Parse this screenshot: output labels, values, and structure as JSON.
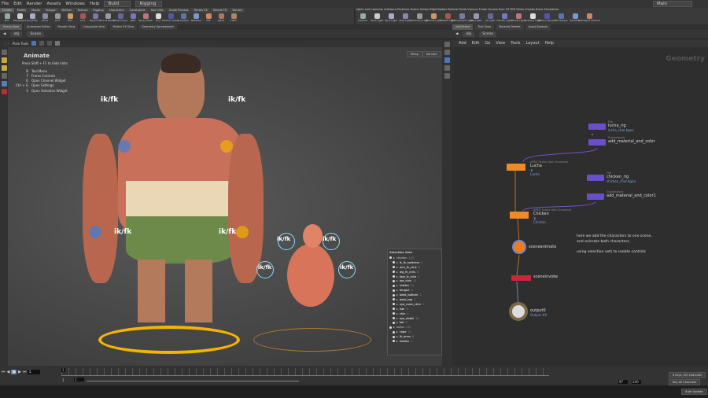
{
  "menubar": {
    "items": [
      "File",
      "Edit",
      "Render",
      "Assets",
      "Windows",
      "Help"
    ],
    "desktop": "Build",
    "context": "Rigging",
    "right_desktop": "Main"
  },
  "shelf_tabs_left": [
    "Create",
    "Modify",
    "Model",
    "Polygon",
    "Deform",
    "Texture",
    "Rigging",
    "Characters",
    "Constraints",
    "Hair Utils",
    "Guide Process",
    "Terrain FX",
    "Simple FX",
    "Volume"
  ],
  "shelf_tabs_right": [
    "Lights and Cameras",
    "Collisions",
    "Particles",
    "Grains",
    "Vellum",
    "Rigid Bodies",
    "Particle Fluids",
    "Viscous Fluids",
    "Oceans",
    "Pyro FX",
    "FEM",
    "Wires",
    "Crowds",
    "Drive Simulation"
  ],
  "shelf_tools_left": [
    "Box",
    "PolySphere",
    "PolyTube",
    "Torus",
    "Grid",
    "Null",
    "Line",
    "PolyCircle",
    "Curve Bezier",
    "Draw Curve",
    "Path",
    "Spray Paint",
    "Font",
    "Platonic Solids",
    "L-System",
    "Metaball",
    "File",
    "Spiral",
    "Helix"
  ],
  "shelf_tools_right": [
    "Camera",
    "Point Light",
    "Spot Light",
    "Area Light",
    "Geometry Light",
    "Volume Light",
    "Distant Light",
    "Environment Light",
    "Sky Light",
    "GI Light",
    "Caustic Light",
    "Portal Light",
    "Ambient Light",
    "Stereo Camera",
    "VR Camera",
    "Switcher",
    "Gamepad Camera"
  ],
  "left_pane_tabs": [
    "Scene View",
    "Animation Editor",
    "Render View",
    "Composite View",
    "Motion FX View",
    "Geometry Spreadsheet"
  ],
  "right_pane_tabs": [
    "/obj/Scene",
    "Tree View",
    "Material Palette",
    "Asset Browser"
  ],
  "path": {
    "obj": "obj",
    "scene": "Scene"
  },
  "viewport": {
    "pose_tools": "Pose Tools",
    "camera": "Persp",
    "lights": "No cam",
    "hud_title": "Animate",
    "hud_hint": "Press Shift + F1 to hide hints",
    "hotkeys": [
      {
        "k": "B",
        "a": "Tool Menu"
      },
      {
        "k": "F",
        "a": "Frame Controls"
      },
      {
        "k": "G",
        "a": "Open Channel Widget"
      },
      {
        "k": "Ctrl + G",
        "a": "Open Settings"
      },
      {
        "k": "V",
        "a": "Open Selection Widget"
      }
    ],
    "ikfk_label": "ik/fk"
  },
  "selection_sets": {
    "title": "Selection Sets",
    "items": [
      {
        "name": "chicken",
        "count": "105",
        "level": 0
      },
      {
        "name": "ik_fk_switches",
        "count": "4",
        "level": 1
      },
      {
        "name": "arm_fk_ctrls",
        "count": "6",
        "level": 1
      },
      {
        "name": "leg_fk_ctrls",
        "count": "6",
        "level": 1
      },
      {
        "name": "foot_ik_ctrls",
        "count": "4",
        "level": 1
      },
      {
        "name": "toe_ctrls",
        "count": "11",
        "level": 1
      },
      {
        "name": "hidden",
        "count": "12",
        "level": 1
      },
      {
        "name": "tongue",
        "count": "4",
        "level": 1
      },
      {
        "name": "beak_bottom",
        "count": "1",
        "level": 1
      },
      {
        "name": "beak_top",
        "count": "1",
        "level": 1
      },
      {
        "name": "eye_main_ctrls",
        "count": "2",
        "level": 1
      },
      {
        "name": "hair",
        "count": "3",
        "level": 1
      },
      {
        "name": "chin",
        "count": "1",
        "level": 1
      },
      {
        "name": "eye_detail",
        "count": "10",
        "level": 1
      },
      {
        "name": "tail",
        "count": "3",
        "level": 1
      },
      {
        "name": "lucha",
        "count": "139",
        "level": 0
      },
      {
        "name": "cape",
        "count": "11",
        "level": 1
      },
      {
        "name": "fk_arms",
        "count": "6",
        "level": 1
      },
      {
        "name": "hidden",
        "count": "4",
        "level": 1
      }
    ]
  },
  "network": {
    "menu": [
      "Add",
      "Edit",
      "Go",
      "View",
      "Tools",
      "Layout",
      "Help"
    ],
    "context_label": "Geometry",
    "nodes": {
      "lucha_rig": {
        "type": "File",
        "name": "lucha_rig",
        "sub": "lucha_char.bgeo"
      },
      "add_mat": {
        "type": "Subnetwork",
        "name": "add_material_and_color"
      },
      "lucha": {
        "type": "APEX Scene Add Character",
        "name": "Lucha",
        "flag": "♛",
        "sub": "Lucha"
      },
      "chicken_rig": {
        "type": "File",
        "name": "chicken_rig",
        "sub": "chicken_char.bgeo"
      },
      "add_mat1": {
        "type": "Subnetwork",
        "name": "add_material_and_color1"
      },
      "chicken": {
        "type": "APEX Scene Add Character",
        "name": "Chicken",
        "flag": "♛",
        "sub": "Chicken"
      },
      "sceneanimate": {
        "name": "sceneanimate"
      },
      "sceneinvoke": {
        "name": "sceneinvoke"
      },
      "output0": {
        "name": "output0",
        "sub": "Output #0"
      }
    },
    "comment": [
      "here we add the characters to one scene,",
      "and animate both characters.",
      "",
      "using selection sets to isolate controls"
    ]
  },
  "timeline": {
    "current_frame": "1",
    "range_start": "1",
    "range_start2": "1",
    "end_a": "97",
    "end_b": "240",
    "keys_info": "0 keys, 0/0 channels",
    "key_all": "Key All Channels",
    "auto_update": "Auto Update"
  },
  "colors": {
    "orange_node": "#f08a24",
    "purple_node": "#6a4fc8",
    "red_node": "#d0243a",
    "ikfk_ring": "#f5b400"
  }
}
